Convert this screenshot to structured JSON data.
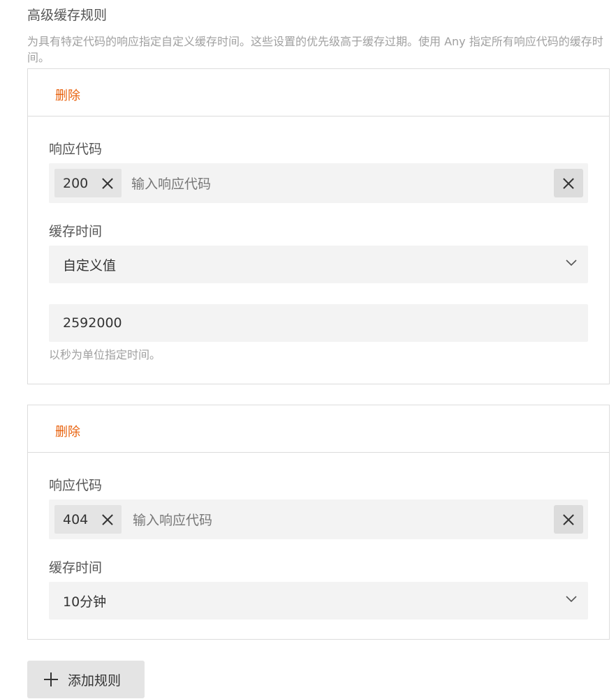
{
  "section": {
    "title": "高级缓存规则",
    "description": "为具有特定代码的响应指定自定义缓存时间。这些设置的优先级高于缓存过期。使用 Any 指定所有响应代码的缓存时间。"
  },
  "rules": [
    {
      "delete_label": "删除",
      "codes_label": "响应代码",
      "codes": [
        "200"
      ],
      "codes_placeholder": "输入响应代码",
      "cache_time_label": "缓存时间",
      "cache_time_selected": "自定义值",
      "custom_value": "2592000",
      "hint": "以秒为单位指定时间。"
    },
    {
      "delete_label": "删除",
      "codes_label": "响应代码",
      "codes": [
        "404"
      ],
      "codes_placeholder": "输入响应代码",
      "cache_time_label": "缓存时间",
      "cache_time_selected": "10分钟"
    }
  ],
  "add_rule_label": "添加规则",
  "icons": {
    "chip_remove": "close-icon",
    "clear": "close-icon",
    "select": "chevron-down-icon",
    "add": "plus-icon"
  },
  "colors": {
    "delete_link": "#e8620e",
    "field_background": "#f3f3f3",
    "chip_background": "#e4e4e4"
  }
}
